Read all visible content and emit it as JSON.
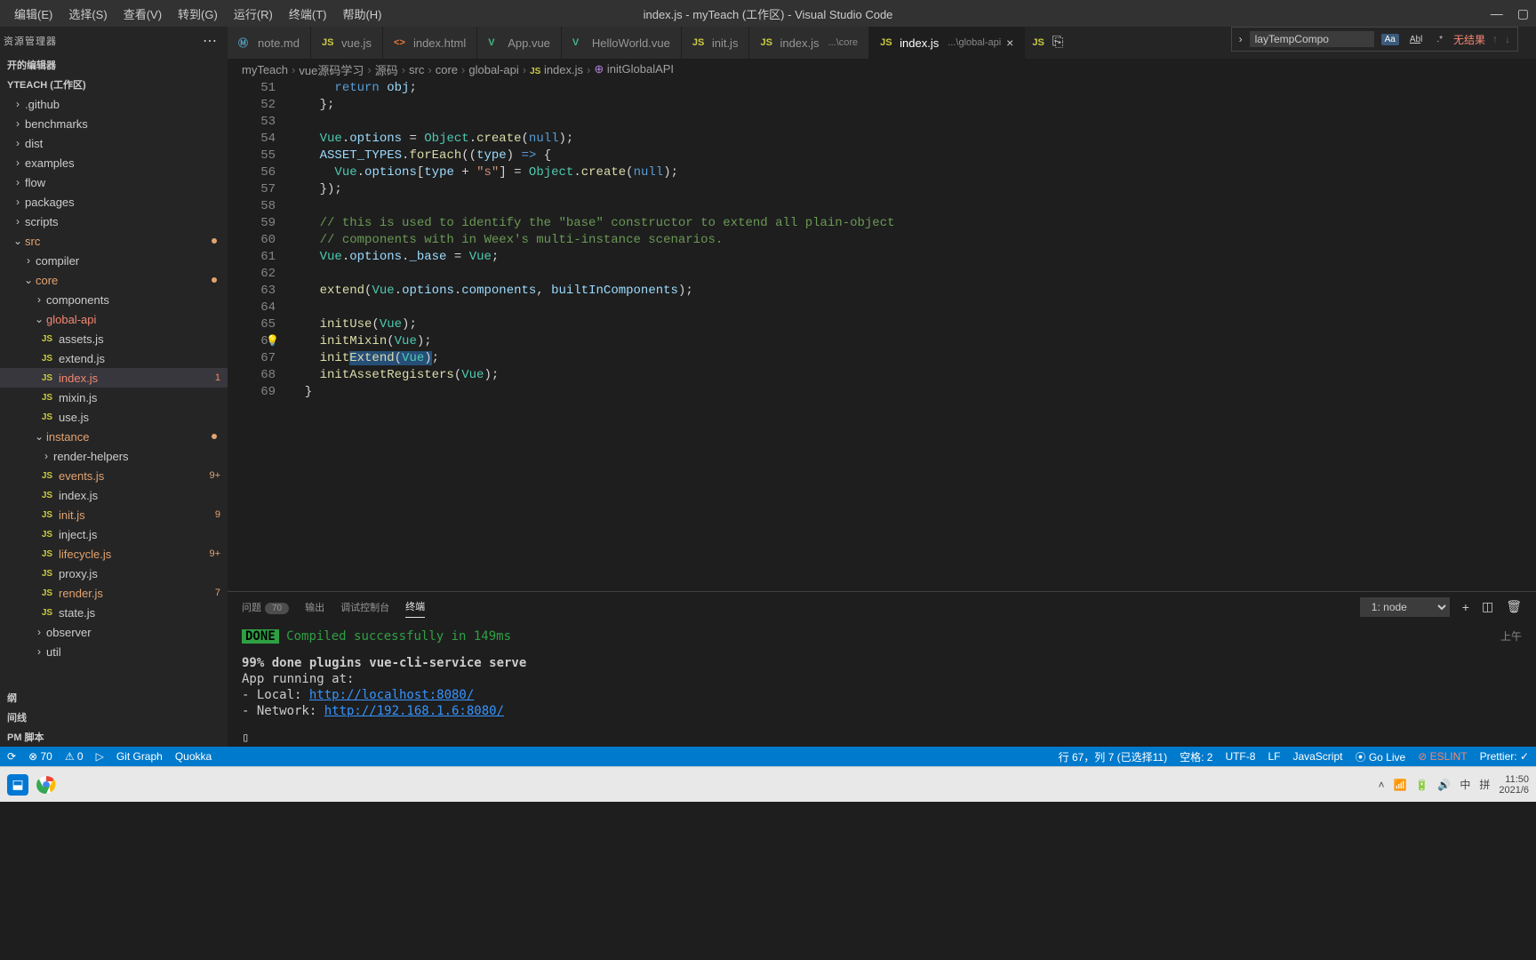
{
  "window": {
    "title": "index.js - myTeach (工作区) - Visual Studio Code"
  },
  "menubar": [
    "编辑(E)",
    "选择(S)",
    "查看(V)",
    "转到(G)",
    "运行(R)",
    "终端(T)",
    "帮助(H)"
  ],
  "sidebar": {
    "title": "资源管理器",
    "section1": "开的编辑器",
    "workspace": "YTEACH (工作区)",
    "tree": {
      "github": ".github",
      "benchmarks": "benchmarks",
      "dist": "dist",
      "examples": "examples",
      "flow": "flow",
      "packages": "packages",
      "scripts": "scripts",
      "src": "src",
      "compiler": "compiler",
      "core": "core",
      "components": "components",
      "globalapi": "global-api",
      "assets": "assets.js",
      "extend": "extend.js",
      "index": "index.js",
      "index_badge": "1",
      "mixin": "mixin.js",
      "use": "use.js",
      "instance": "instance",
      "renderhelpers": "render-helpers",
      "events": "events.js",
      "events_badge": "9+",
      "indexjs": "index.js",
      "init": "init.js",
      "init_badge": "9",
      "inject": "inject.js",
      "lifecycle": "lifecycle.js",
      "lifecycle_badge": "9+",
      "proxy": "proxy.js",
      "render": "render.js",
      "render_badge": "7",
      "state": "state.js",
      "observer": "observer",
      "util": "util"
    },
    "section_outline": "纲",
    "section_timeline": "间线",
    "section_npm": "PM 脚本"
  },
  "tabs": [
    {
      "icon": "md",
      "label": "note.md"
    },
    {
      "icon": "js",
      "label": "vue.js"
    },
    {
      "icon": "html",
      "label": "index.html"
    },
    {
      "icon": "vue",
      "label": "App.vue"
    },
    {
      "icon": "vue",
      "label": "HelloWorld.vue"
    },
    {
      "icon": "js",
      "label": "init.js"
    },
    {
      "icon": "js",
      "label": "index.js",
      "sub": "...\\core"
    },
    {
      "icon": "js",
      "label": "index.js",
      "sub": "...\\global-api",
      "active": true
    }
  ],
  "breadcrumbs": [
    "myTeach",
    "vue源码学习",
    "源码",
    "src",
    "core",
    "global-api",
    "index.js",
    "initGlobalAPI"
  ],
  "find": {
    "value": "layTempCompo",
    "noresult": "无结果"
  },
  "code": {
    "start": 51,
    "lines": [
      {
        "n": 51,
        "html": "      <span class='tok-kw'>return</span> <span class='tok-var'>obj</span>;"
      },
      {
        "n": 52,
        "html": "    };"
      },
      {
        "n": 53,
        "html": ""
      },
      {
        "n": 54,
        "html": "    <span class='tok-type'>Vue</span>.<span class='tok-prop'>options</span> = <span class='tok-type'>Object</span>.<span class='tok-fn'>create</span>(<span class='tok-const'>null</span>);"
      },
      {
        "n": 55,
        "html": "    <span class='tok-var'>ASSET_TYPES</span>.<span class='tok-fn'>forEach</span>((<span class='tok-var'>type</span>) <span class='tok-kw'>=&gt;</span> {"
      },
      {
        "n": 56,
        "html": "      <span class='tok-type'>Vue</span>.<span class='tok-prop'>options</span>[<span class='tok-var'>type</span> + <span class='tok-str'>\"s\"</span>] = <span class='tok-type'>Object</span>.<span class='tok-fn'>create</span>(<span class='tok-const'>null</span>);"
      },
      {
        "n": 57,
        "html": "    });"
      },
      {
        "n": 58,
        "html": ""
      },
      {
        "n": 59,
        "html": "    <span class='tok-comment'>// this is used to identify the \"base\" constructor to extend all plain-object</span>"
      },
      {
        "n": 60,
        "html": "    <span class='tok-comment'>// components with in Weex's multi-instance scenarios.</span>"
      },
      {
        "n": 61,
        "html": "    <span class='tok-type'>Vue</span>.<span class='tok-prop'>options</span>.<span class='tok-prop'>_base</span> = <span class='tok-type'>Vue</span>;"
      },
      {
        "n": 62,
        "html": ""
      },
      {
        "n": 63,
        "html": "    <span class='tok-fn'>extend</span>(<span class='tok-type'>Vue</span>.<span class='tok-prop'>options</span>.<span class='tok-prop'>components</span>, <span class='tok-var'>builtInComponents</span>);"
      },
      {
        "n": 64,
        "html": ""
      },
      {
        "n": 65,
        "html": "    <span class='tok-fn'>initUse</span>(<span class='tok-type'>Vue</span>);"
      },
      {
        "n": 66,
        "html": "    <span class='tok-fn'>initMixin</span>(<span class='tok-type'>Vue</span>);",
        "bulb": true
      },
      {
        "n": 67,
        "html": "    <span class='tok-fn'>init</span><span class='sel'><span class='tok-fn'>Extend</span>(<span class='tok-type'>Vue</span>)</span>;"
      },
      {
        "n": 68,
        "html": "    <span class='tok-fn'>initAssetRegisters</span>(<span class='tok-type'>Vue</span>);"
      },
      {
        "n": 69,
        "html": "  }"
      }
    ]
  },
  "panel": {
    "tabs": {
      "problems": "问题",
      "problems_count": "70",
      "output": "输出",
      "debug": "调试控制台",
      "terminal": "终端"
    },
    "terminal_select": "1: node",
    "content": {
      "done": "DONE",
      "compiled": "Compiled successfully in 149ms",
      "line2": "99% done plugins vue-cli-service serve",
      "line3": "  App running at:",
      "line4_label": "  - Local:   ",
      "line4_url": "http://localhost:8080/",
      "line5_label": "  - Network: ",
      "line5_url": "http://192.168.1.6:8080/",
      "cursor": "▯",
      "time": "上午"
    }
  },
  "statusbar": {
    "sync": "⟳",
    "errors": "⊗ 70",
    "warnings": "⚠ 0",
    "debug": "▷",
    "gitgraph": "Git Graph",
    "quokka": "Quokka",
    "cursor": "行 67，列 7 (已选择11)",
    "spaces": "空格: 2",
    "encoding": "UTF-8",
    "eol": "LF",
    "lang": "JavaScript",
    "golive": "⦿ Go Live",
    "eslint": "⊘ ESLINT",
    "prettier": "Prettier: ✓"
  },
  "taskbar": {
    "time": "11:50",
    "date": "2021/6"
  }
}
